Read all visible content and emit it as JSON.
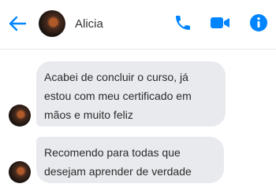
{
  "header": {
    "contact_name": "Alicia",
    "icons": {
      "back": "arrow-left-icon",
      "phone": "phone-icon",
      "video": "video-camera-icon",
      "info": "info-icon"
    },
    "accent_color": "#0084ff"
  },
  "messages": [
    {
      "lines": [
        "Acabei de concluir o curso, já",
        "estou com meu certificado em",
        "mãos e muito feliz"
      ]
    },
    {
      "lines": [
        "Recomendo para todas que",
        "desejam aprender de verdade"
      ]
    }
  ],
  "colors": {
    "bubble_bg": "#e9eaee",
    "text": "#2b2b2b"
  }
}
